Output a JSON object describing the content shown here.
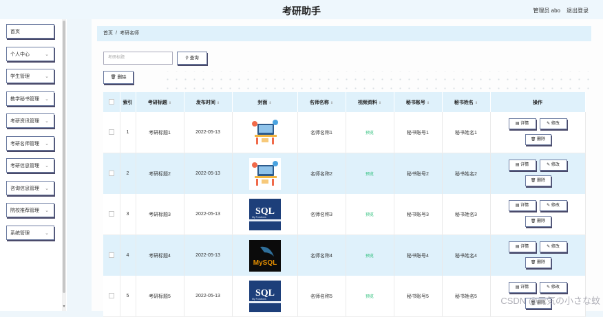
{
  "header": {
    "title": "考研助手",
    "user": "管理员 abo",
    "logout": "退出登录"
  },
  "sidebar": {
    "items": [
      {
        "label": "首页",
        "chevron": false
      },
      {
        "label": "个人中心",
        "chevron": true
      },
      {
        "label": "学生管理",
        "chevron": true
      },
      {
        "label": "教学秘书管理",
        "chevron": true
      },
      {
        "label": "考研资讯管理",
        "chevron": true
      },
      {
        "label": "考研名师管理",
        "chevron": true
      },
      {
        "label": "考研信息管理",
        "chevron": true
      },
      {
        "label": "咨询信息管理",
        "chevron": true
      },
      {
        "label": "院校推荐管理",
        "chevron": true
      },
      {
        "label": "系统管理",
        "chevron": true
      }
    ]
  },
  "breadcrumb": {
    "home": "首页",
    "separator": "/",
    "current": "考研名师"
  },
  "search": {
    "placeholder": "考研标题",
    "button": "查询"
  },
  "toolbar": {
    "delete": "删除"
  },
  "table": {
    "headers": [
      "索引",
      "考研标题",
      "发布时间",
      "封面",
      "名师名称",
      "视频资料",
      "秘书账号",
      "秘书姓名",
      "操作"
    ],
    "rows": [
      {
        "index": "1",
        "title": "考研标题1",
        "date": "2022-05-13",
        "cover": "illustration",
        "teacher": "名师名称1",
        "video": "预览",
        "sec_account": "秘书账号1",
        "sec_name": "秘书姓名1"
      },
      {
        "index": "2",
        "title": "考研标题2",
        "date": "2022-05-13",
        "cover": "illustration",
        "teacher": "名师名称2",
        "video": "预览",
        "sec_account": "秘书账号2",
        "sec_name": "秘书姓名2"
      },
      {
        "index": "3",
        "title": "考研标题3",
        "date": "2022-05-13",
        "cover": "sql-book",
        "teacher": "名师名称3",
        "video": "预览",
        "sec_account": "秘书账号3",
        "sec_name": "秘书姓名3"
      },
      {
        "index": "4",
        "title": "考研标题4",
        "date": "2022-05-13",
        "cover": "mysql-logo",
        "teacher": "名师名称4",
        "video": "预览",
        "sec_account": "秘书账号4",
        "sec_name": "秘书姓名4"
      },
      {
        "index": "5",
        "title": "考研标题5",
        "date": "2022-05-13",
        "cover": "sql-book",
        "teacher": "名师名称5",
        "video": "预览",
        "sec_account": "秘书账号5",
        "sec_name": "秘书姓名5"
      }
    ],
    "actions": {
      "detail": "详情",
      "edit": "修改",
      "delete": "删除"
    }
  },
  "cover_text": {
    "sql": "SQL",
    "sql_sub": "My Functions",
    "mysql": "MySQL"
  },
  "watermark": "CSDN @元気の小さな蚊",
  "colors": {
    "accent": "#dff1fb",
    "preview": "#2bbf7a",
    "button_border": "#6b7aa0"
  }
}
